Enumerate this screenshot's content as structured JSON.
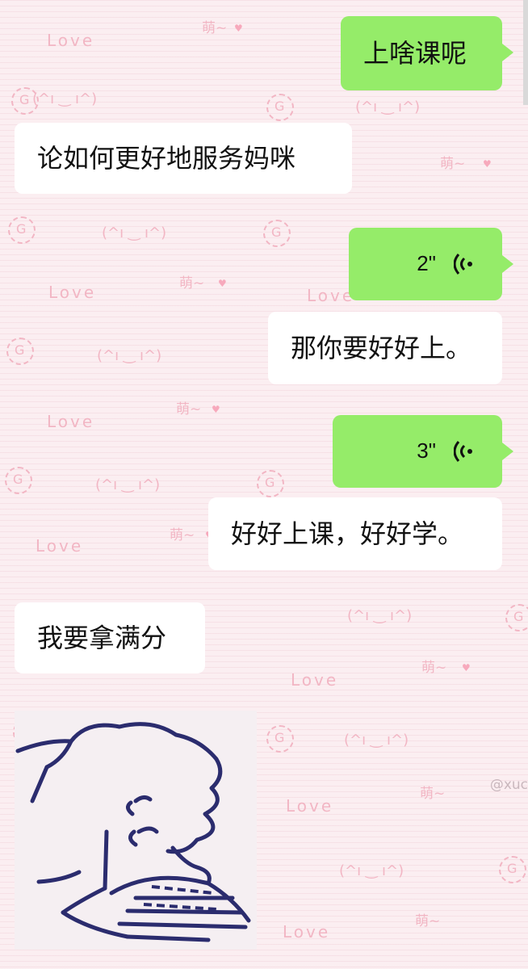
{
  "messages": [
    {
      "id": "m1",
      "side": "right",
      "type": "text",
      "text": "上啥课呢"
    },
    {
      "id": "m2",
      "side": "left",
      "type": "text",
      "text": "论如何更好地服务妈咪"
    },
    {
      "id": "m3",
      "side": "right",
      "type": "voice",
      "duration": "2\""
    },
    {
      "id": "m4",
      "side": "left",
      "type": "text",
      "text": "那你要好好上。"
    },
    {
      "id": "m5",
      "side": "right",
      "type": "voice",
      "duration": "3\""
    },
    {
      "id": "m6",
      "side": "left",
      "type": "text",
      "text": "好好上课，好好学。"
    },
    {
      "id": "m7",
      "side": "left",
      "type": "text",
      "text": "我要拿满分"
    },
    {
      "id": "m8",
      "side": "left",
      "type": "sticker",
      "icon": "sleeping-reading-cat-sticker"
    }
  ],
  "wallpaper": {
    "love_text": "Love",
    "face_text": "(^ı ‿ ı^)",
    "moe_text": "萌~",
    "watermark": "@xuc"
  },
  "colors": {
    "my_bubble": "#95ec69",
    "their_bubble": "#ffffff",
    "background": "#fbeef1",
    "decoration": "#f2b6c4"
  }
}
